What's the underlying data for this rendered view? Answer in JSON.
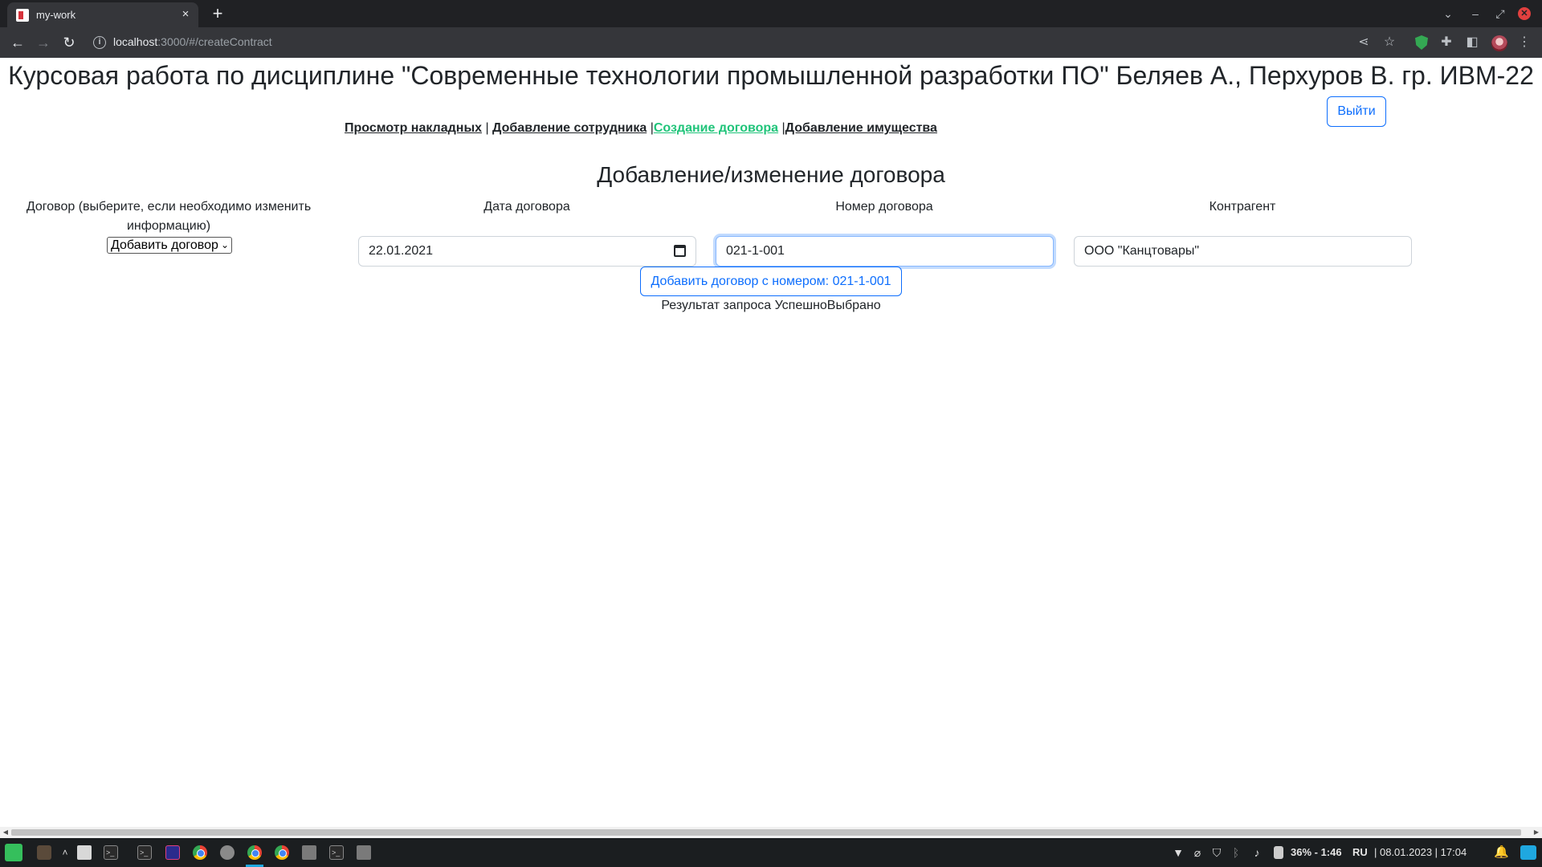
{
  "browser": {
    "tab_title": "my-work",
    "tab_close": "×",
    "new_tab": "+",
    "url_host": "localhost",
    "url_path": ":3000/#/createContract"
  },
  "page": {
    "title": "Курсовая работа по дисциплине \"Современные технологии промышленной разработки ПО\" Беляев А., Перхуров В. гр. ИВМ-22",
    "logout_label": "Выйти",
    "nav": {
      "item1": "Просмотр накладных",
      "sep1": " | ",
      "item2": "Добавление сотрудника",
      "sep2": " |",
      "item3": "Создание договора",
      "sep3": " |",
      "item4": "Добавление имущества"
    },
    "section_title": "Добавление/изменение договора",
    "form": {
      "contract_label": "Договор (выберите, если необходимо изменить информацию)",
      "contract_selected": "Добавить договор",
      "date_label": "Дата договора",
      "date_value": "22.01.2021",
      "number_label": "Номер договора",
      "number_value": "021-1-001",
      "counterparty_label": "Контрагент",
      "counterparty_value": "ООО \"Канцтовары\"",
      "submit_label": "Добавить договор с номером: 021-1-001"
    },
    "result_text": "Результат запроса УспешноВыбрано"
  },
  "taskbar": {
    "battery": "36% - 1:46",
    "lang": "RU",
    "datetime": "| 08.01.2023 | 17:04"
  },
  "colors": {
    "accent": "#0d6efd",
    "active_nav": "#20c47a",
    "browser_dark": "#202124"
  }
}
